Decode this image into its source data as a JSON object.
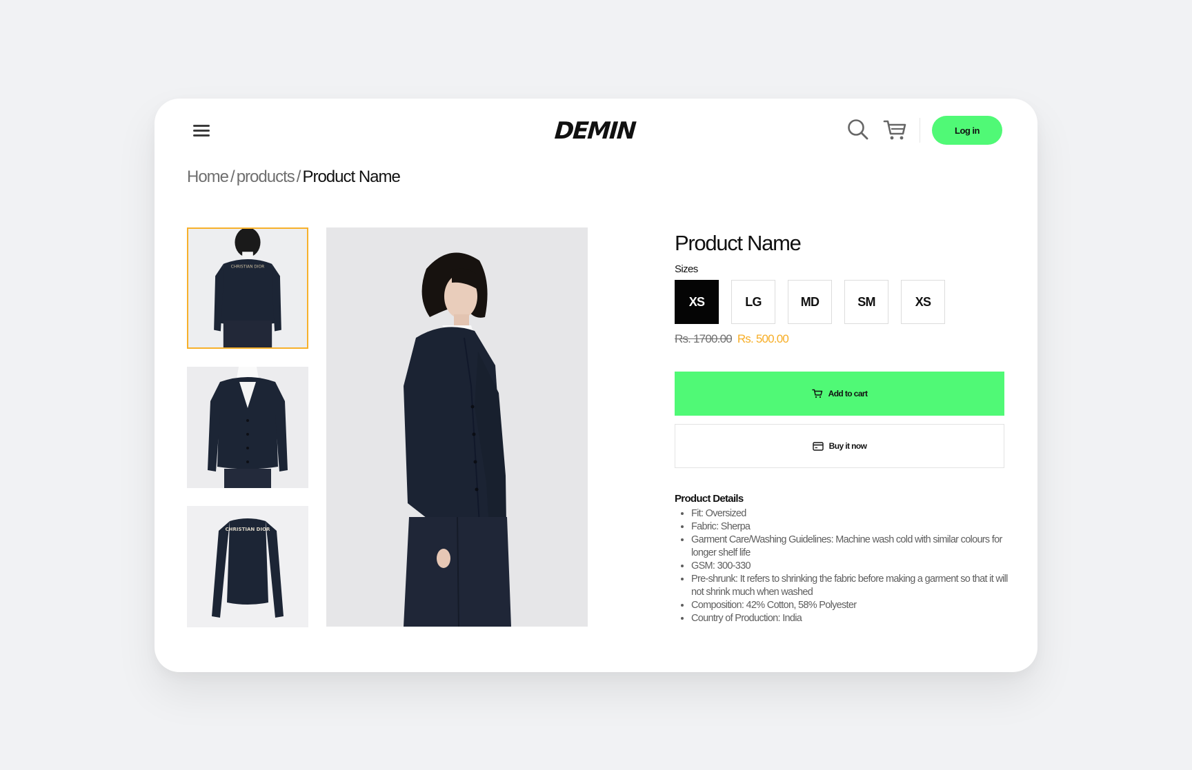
{
  "header": {
    "logo_text": "DEMIN",
    "login_label": "Log in",
    "icons": {
      "menu": "hamburger-menu-icon",
      "search": "search-icon",
      "cart": "shopping-cart-icon"
    }
  },
  "breadcrumb": {
    "items": [
      "Home",
      "products"
    ],
    "separator": "/",
    "current": "Product Name"
  },
  "gallery": {
    "thumbnails": [
      {
        "label": "CHRISTIAN DIOR",
        "view": "back",
        "selected": true
      },
      {
        "label": "",
        "view": "front",
        "selected": false
      },
      {
        "label": "CHRISTIAN DIOR",
        "view": "flat-back",
        "selected": false
      }
    ],
    "main_view": "side"
  },
  "product": {
    "title": "Product Name",
    "sizes_label": "Sizes",
    "sizes": [
      "XS",
      "LG",
      "MD",
      "SM",
      "XS"
    ],
    "selected_size_index": 0,
    "original_price": "Rs. 1700.00",
    "sale_price": "Rs. 500.00",
    "add_to_cart_label": "Add to cart",
    "buy_now_label": "Buy it now",
    "details_title": "Product Details",
    "details": [
      "Fit: Oversized",
      "Fabric: Sherpa",
      "Garment Care/Washing Guidelines: Machine wash cold with similar colours for longer shelf life",
      "GSM: 300-330",
      "Pre-shrunk: It refers to shrinking the fabric before making a garment so that it will not shrink much when washed",
      "Composition: 42% Cotton, 58% Polyester",
      "Country of Production: India"
    ]
  },
  "colors": {
    "accent_green": "#50f976",
    "sale_orange": "#f7ae27",
    "selected_thumb_border": "#f7b02a",
    "background": "#f1f2f4",
    "garment_navy": "#1b2333"
  }
}
